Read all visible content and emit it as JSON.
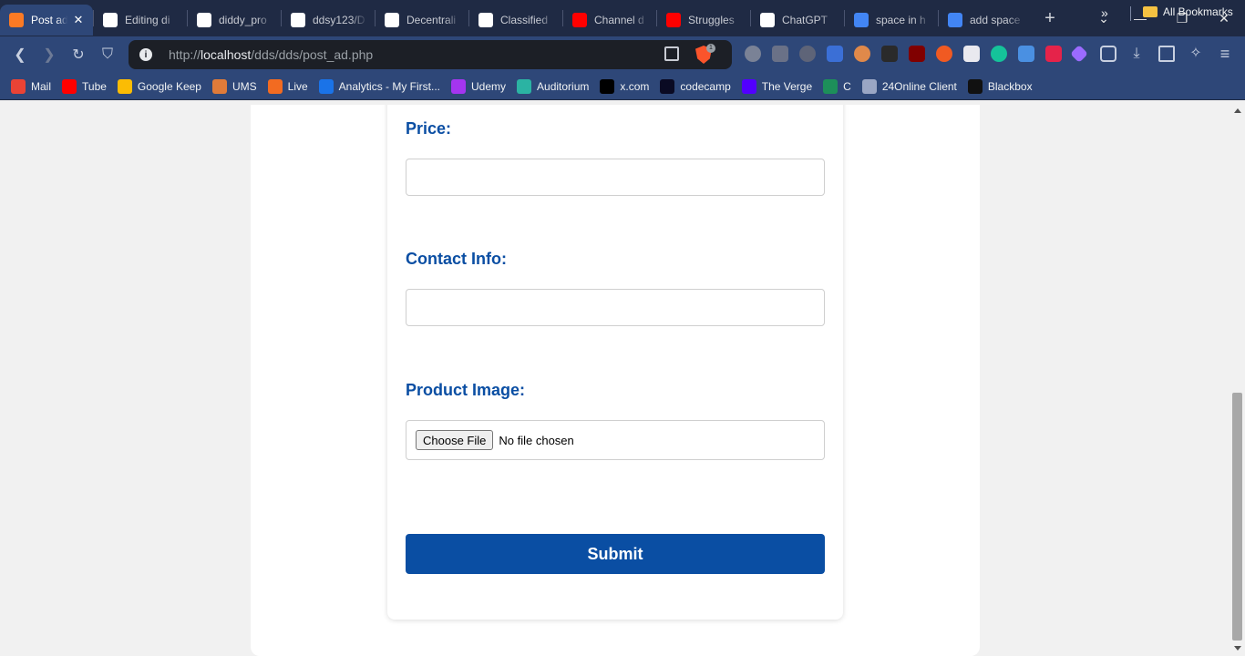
{
  "browser": {
    "tabs": [
      {
        "title": "Post ad",
        "icon": "xampp-icon",
        "color": "#fb7a24",
        "active": true
      },
      {
        "title": "Editing di",
        "icon": "github-icon",
        "color": "#ffffff"
      },
      {
        "title": "diddy_pro",
        "icon": "github-icon",
        "color": "#ffffff"
      },
      {
        "title": "ddsy123/D",
        "icon": "github-icon",
        "color": "#ffffff"
      },
      {
        "title": "Decentrali",
        "icon": "github-icon",
        "color": "#ffffff"
      },
      {
        "title": "Classified",
        "icon": "chatgpt-icon",
        "color": "#ffffff"
      },
      {
        "title": "Channel d",
        "icon": "youtube-icon",
        "color": "#ff0000"
      },
      {
        "title": "Struggles",
        "icon": "youtube-icon",
        "color": "#ff0000"
      },
      {
        "title": "ChatGPT",
        "icon": "chatgpt-icon",
        "color": "#ffffff"
      },
      {
        "title": "space in h",
        "icon": "google-icon",
        "color": "#4285f4"
      },
      {
        "title": "add space",
        "icon": "google-icon",
        "color": "#4285f4"
      }
    ],
    "url_prefix": "http://",
    "url_host": "localhost",
    "url_path": "/dds/dds/post_ad.php",
    "brave_badge": "1",
    "bookmarks": [
      {
        "label": "Mail",
        "icon": "gmail-icon",
        "color": "#ea4335"
      },
      {
        "label": "Tube",
        "icon": "youtube-icon",
        "color": "#ff0000"
      },
      {
        "label": "Google Keep",
        "icon": "keep-icon",
        "color": "#fbbc04"
      },
      {
        "label": "UMS",
        "icon": "ums-icon",
        "color": "#e07b39"
      },
      {
        "label": "Live",
        "icon": "live-icon",
        "color": "#f26b21"
      },
      {
        "label": "Analytics - My First...",
        "icon": "shield-icon",
        "color": "#1a73e8"
      },
      {
        "label": "Udemy",
        "icon": "udemy-icon",
        "color": "#a435f0"
      },
      {
        "label": "Auditorium",
        "icon": "auditorium-icon",
        "color": "#2bb3a3"
      },
      {
        "label": "x.com",
        "icon": "x-icon",
        "color": "#000000"
      },
      {
        "label": "codecamp",
        "icon": "codecamp-icon",
        "color": "#0a0a23"
      },
      {
        "label": "The Verge",
        "icon": "verge-icon",
        "color": "#5200ff"
      },
      {
        "label": "C",
        "icon": "w-icon",
        "color": "#1d8f5a"
      },
      {
        "label": "24Online Client",
        "icon": "cloud-icon",
        "color": "#9aa6c4"
      },
      {
        "label": "Blackbox",
        "icon": "blackbox-icon",
        "color": "#111111"
      }
    ],
    "all_bookmarks": "All Bookmarks"
  },
  "form": {
    "price_label": "Price:",
    "price_value": "",
    "contact_label": "Contact Info:",
    "contact_value": "",
    "image_label": "Product Image:",
    "choose_file": "Choose File",
    "no_file": "No file chosen",
    "submit": "Submit"
  },
  "colors": {
    "accent": "#0a4ea3",
    "tabstrip": "#1f2a44",
    "toolbar": "#2e4778"
  }
}
